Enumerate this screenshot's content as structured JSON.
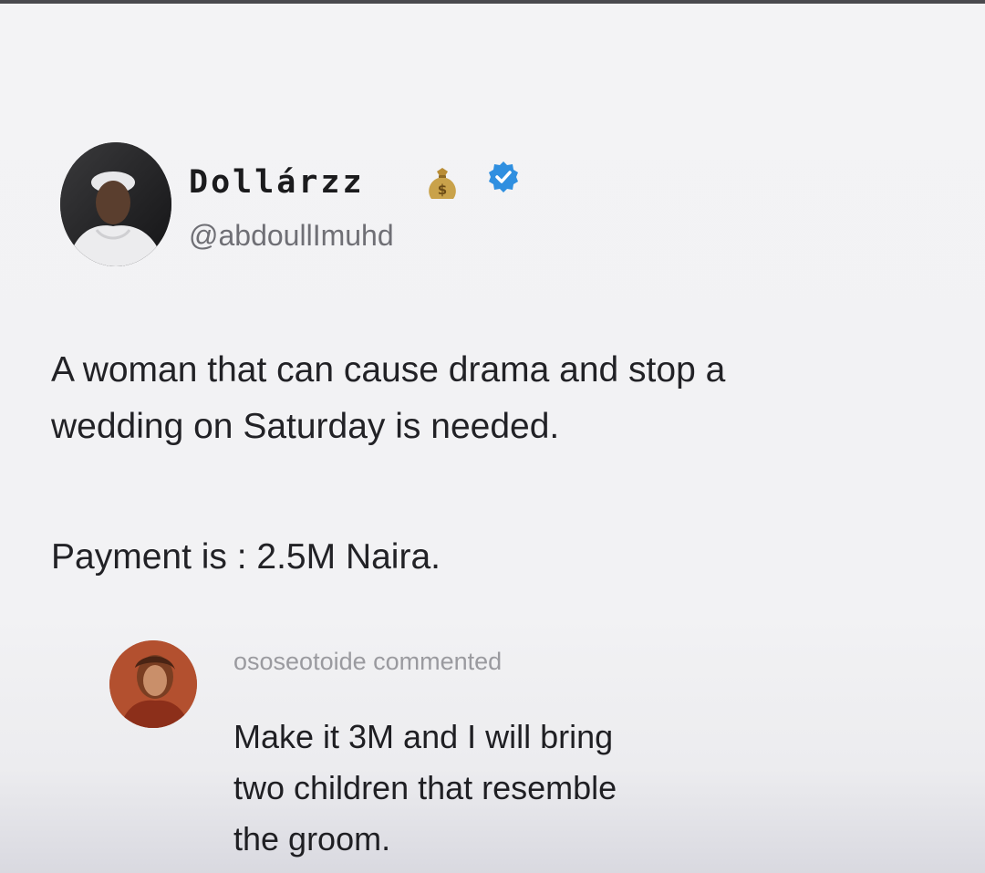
{
  "post": {
    "author": {
      "display_name": "Dollárzz",
      "handle": "@abdoullImuhd",
      "name_emoji": "money-bag-icon",
      "verified_icon": "verified-badge-icon",
      "avatar": "profile-avatar"
    },
    "text_lines": [
      "A woman that can cause drama and stop a",
      "wedding on Saturday is needed."
    ],
    "payment_line": "Payment is : 2.5M Naira."
  },
  "comment": {
    "header": "ososeotoide commented",
    "avatar": "commenter-avatar",
    "text_lines": [
      "Make it 3M and I will bring",
      "two children that resemble",
      "the groom."
    ]
  },
  "colors": {
    "background": "#f2f2f4",
    "text_primary": "#222226",
    "text_secondary": "#6f6f75",
    "text_muted": "#9a9a9f",
    "verified_blue": "#2f8fe0",
    "money_bag": "#c9a24a"
  }
}
